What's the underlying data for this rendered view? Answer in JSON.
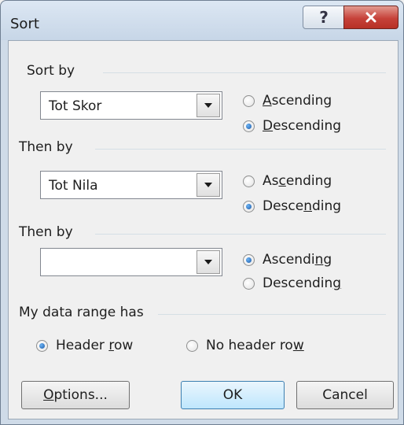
{
  "window": {
    "title": "Sort",
    "help_label": "?",
    "close_label": "x"
  },
  "sort_by": {
    "label": "Sort by",
    "value": "Tot Skor",
    "ascending": "Ascending",
    "descending": "Descending",
    "selected": "Descending"
  },
  "then_by_1": {
    "label": "Then by",
    "value": "Tot Nila",
    "ascending": "Ascending",
    "descending": "Descending",
    "selected": "Descending"
  },
  "then_by_2": {
    "label": "Then by",
    "value": "",
    "ascending": "Ascending",
    "descending": "Descending",
    "selected": "Ascending"
  },
  "data_range": {
    "label": "My data range has",
    "header_row": "Header row",
    "no_header_row": "No header row",
    "selected": "Header row"
  },
  "buttons": {
    "options": "Options...",
    "ok": "OK",
    "cancel": "Cancel"
  }
}
